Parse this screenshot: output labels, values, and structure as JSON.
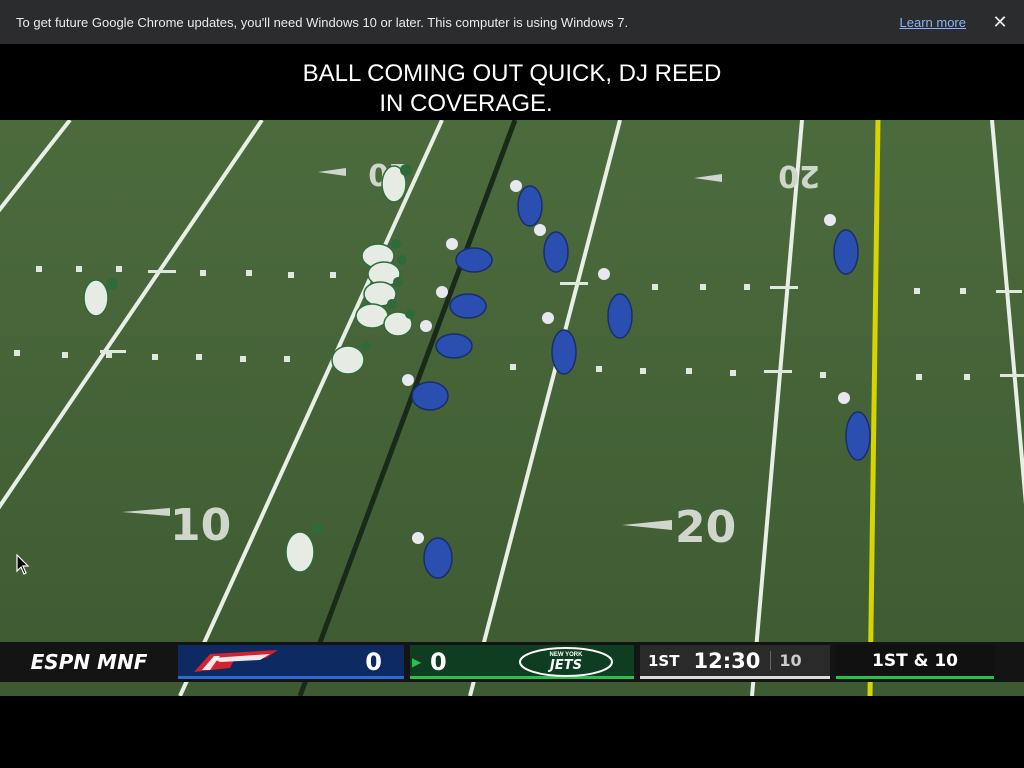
{
  "infobar": {
    "message": "To get future Google Chrome updates, you'll need Windows 10 or later. This computer is using Windows 7.",
    "learn_more": "Learn more",
    "close": "✕"
  },
  "caption": {
    "line1": "BALL COMING OUT QUICK, DJ REED",
    "line2": "IN COVERAGE."
  },
  "field": {
    "yard_numbers": [
      "10",
      "20",
      "10",
      "20"
    ]
  },
  "scorebug": {
    "network": "ESPN MNF",
    "home_team": "Bills",
    "home_score": "0",
    "away_team": "Jets",
    "away_wordmark": "JETS",
    "away_city": "NEW YORK",
    "away_score": "0",
    "quarter": "1ST",
    "clock": "12:30",
    "play_clock": "10",
    "down_distance": "1ST & 10"
  },
  "colors": {
    "field": "#4a6a3c",
    "bills_blue": "#0d2a63",
    "jets_green": "#0e3d22",
    "first_down_line": "#d8d400",
    "los_line": "#1a2a1a"
  }
}
